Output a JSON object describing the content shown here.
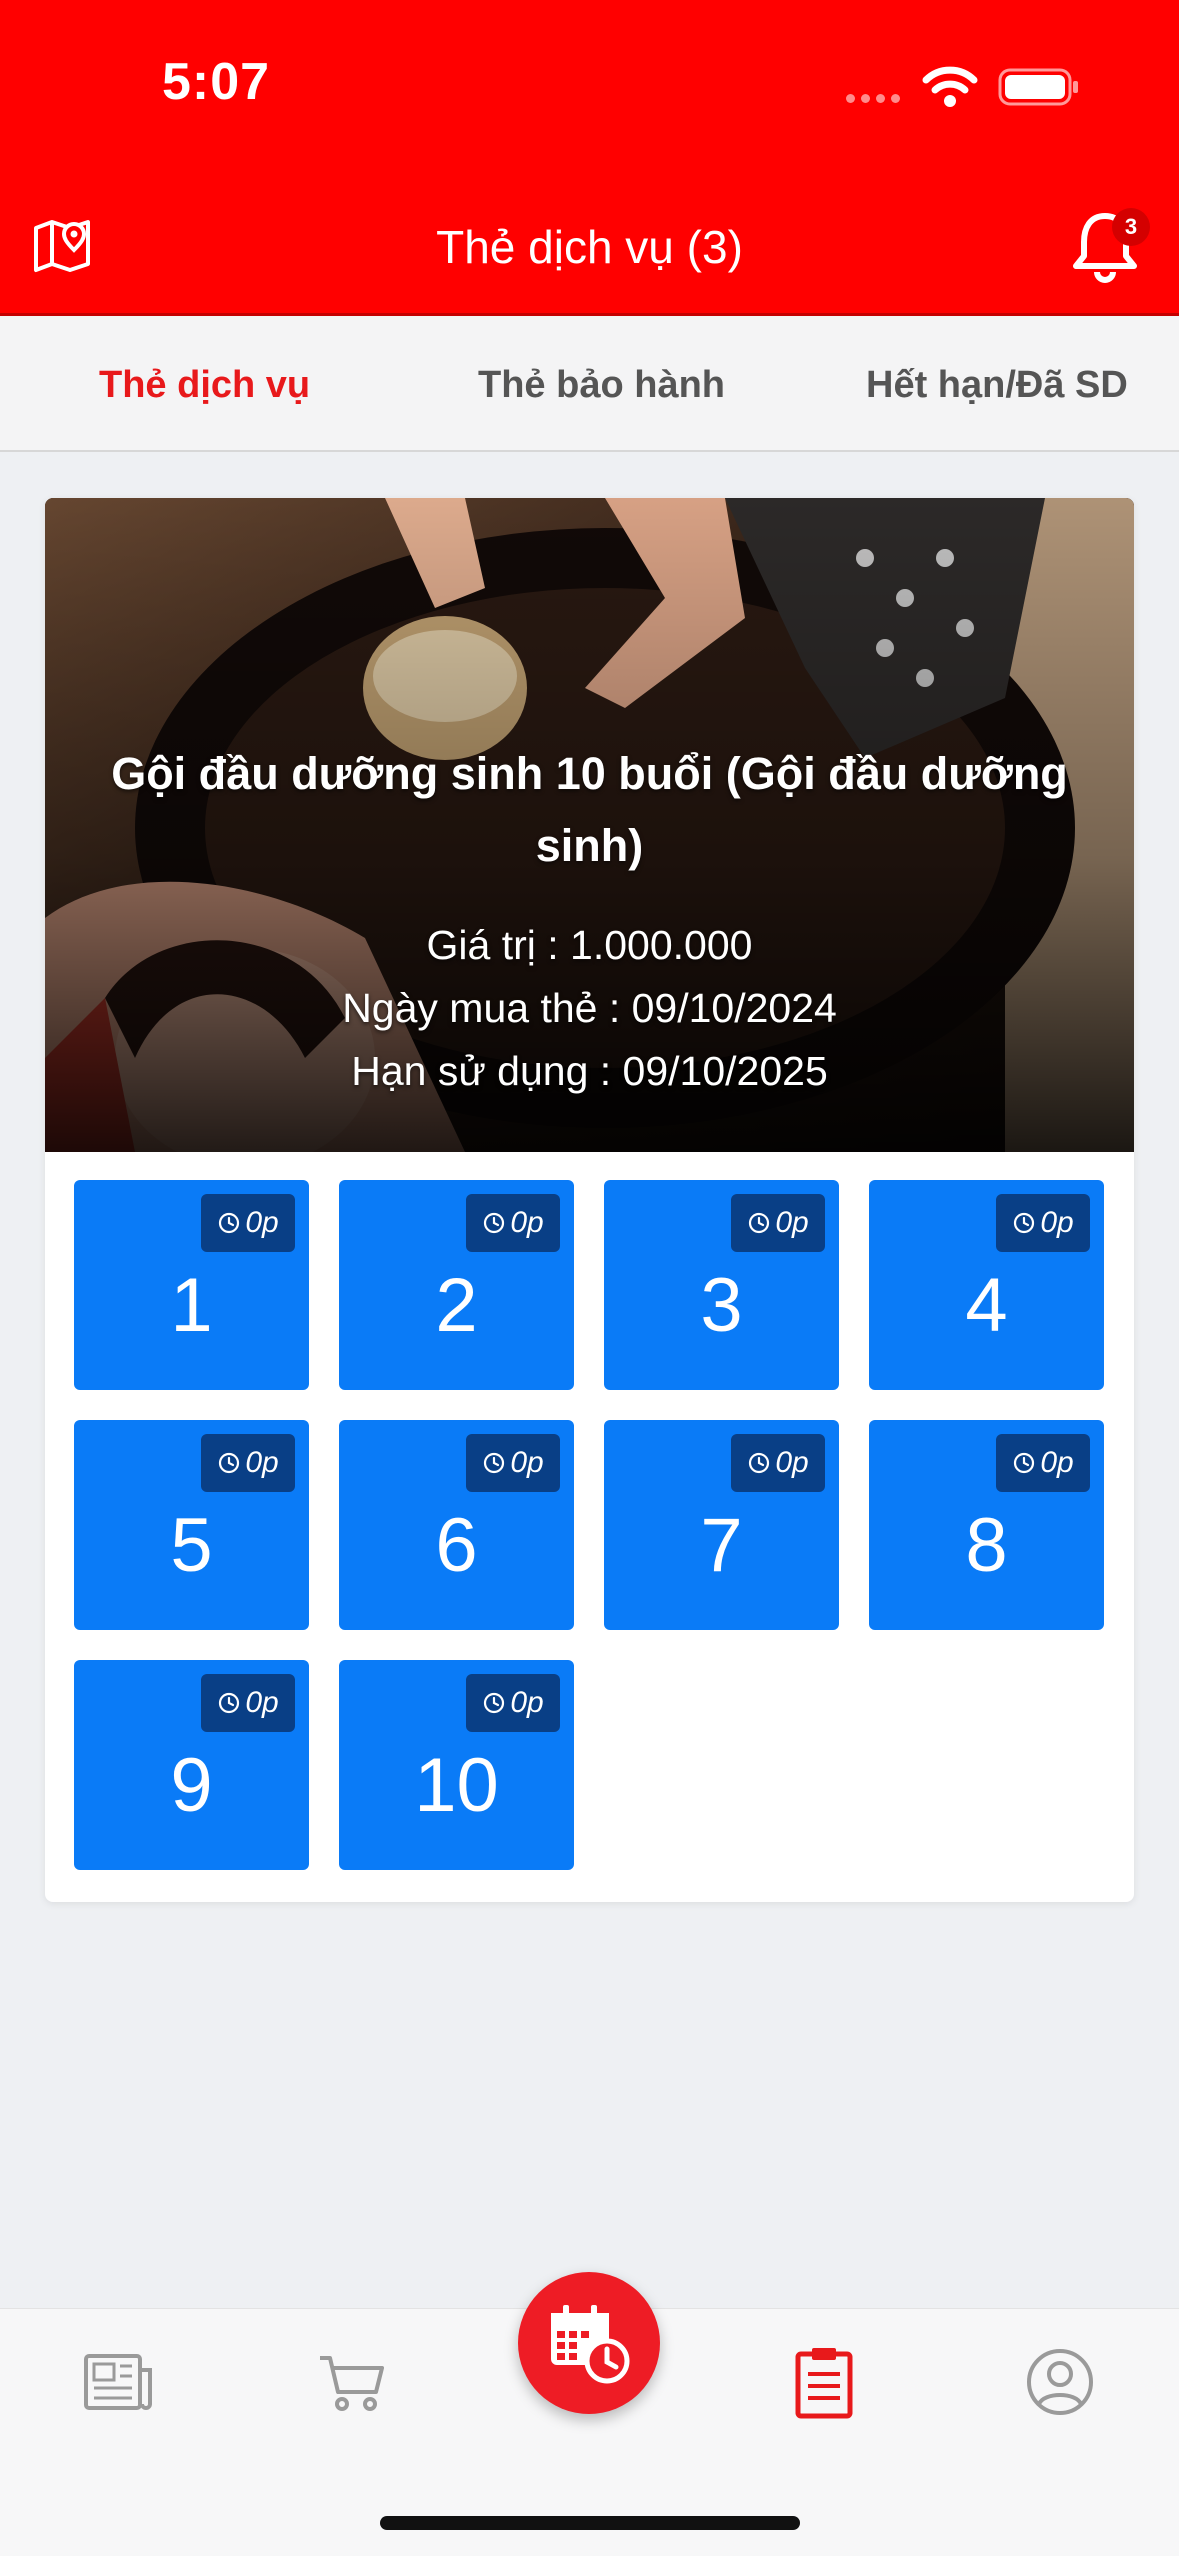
{
  "status_bar": {
    "time": "5:07"
  },
  "header": {
    "title": "Thẻ dịch vụ (3)",
    "notification_count": "3",
    "map_icon": "map-pin-icon",
    "bell_icon": "bell-icon",
    "background_color": "#ff0000"
  },
  "tabs": [
    {
      "label": "Thẻ dịch vụ",
      "active": true
    },
    {
      "label": "Thẻ bảo hành",
      "active": false
    },
    {
      "label": "Hết hạn/Đã SD",
      "active": false
    }
  ],
  "card": {
    "title": "Gội đầu dưỡng sinh 10 buổi (Gội đầu dưỡng sinh)",
    "value": "Giá trị : 1.000.000",
    "purchase_date": "Ngày mua thẻ : 09/10/2024",
    "expiry": "Hạn sử dụng : 09/10/2025",
    "sessions": [
      {
        "number": "1",
        "duration": "0p"
      },
      {
        "number": "2",
        "duration": "0p"
      },
      {
        "number": "3",
        "duration": "0p"
      },
      {
        "number": "4",
        "duration": "0p"
      },
      {
        "number": "5",
        "duration": "0p"
      },
      {
        "number": "6",
        "duration": "0p"
      },
      {
        "number": "7",
        "duration": "0p"
      },
      {
        "number": "8",
        "duration": "0p"
      },
      {
        "number": "9",
        "duration": "0p"
      },
      {
        "number": "10",
        "duration": "0p"
      }
    ],
    "session_color": "#0a7bf7"
  },
  "bottom_nav": {
    "items": [
      {
        "icon": "news-icon",
        "active": false
      },
      {
        "icon": "cart-icon",
        "active": false
      },
      {
        "icon": "calendar-clock-icon",
        "active": false
      },
      {
        "icon": "clipboard-icon",
        "active": true
      },
      {
        "icon": "user-circle-icon",
        "active": false
      }
    ],
    "accent_color": "#e8191b"
  }
}
